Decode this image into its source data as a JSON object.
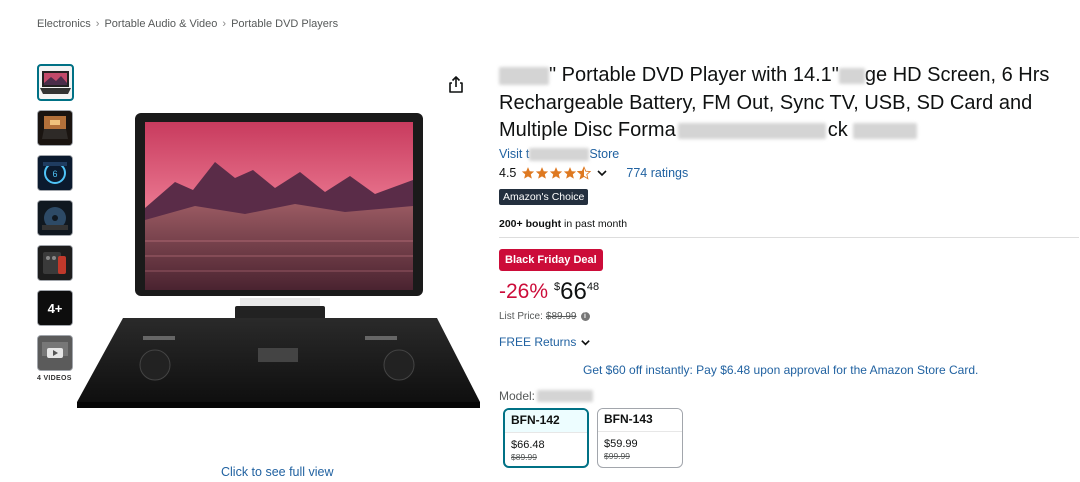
{
  "breadcrumb": [
    "Electronics",
    "Portable Audio & Video",
    "Portable DVD Players"
  ],
  "gallery": {
    "thumbnails": [
      "dvd-player-thumb",
      "battery-thumb",
      "screen-thumb",
      "disc-thumb",
      "remote-thumb",
      "age-4plus-thumb",
      "video-thumb"
    ],
    "thumb_4plus_label": "4+",
    "videos_label": "4 VIDEOS",
    "full_view_link": "Click to see full view"
  },
  "product": {
    "title_part1": "\" Portable DVD Player with 14.1\"",
    "title_part2": "ge HD Screen, 6 Hrs Rechargeable Battery, FM Out, Sync TV, USB, SD Card and Multiple Disc Forma",
    "title_part3": "ck",
    "store_prefix": "Visit t",
    "store_suffix": "Store",
    "rating": "4.5",
    "ratings_count": "774 ratings",
    "choice_badge": "Amazon's Choice",
    "bought_bold": "200+ bought",
    "bought_rest": " in past month"
  },
  "pricing": {
    "deal_badge": "Black Friday Deal",
    "discount": "-26%",
    "currency": "$",
    "price_whole": "66",
    "price_fraction": "48",
    "list_price_label": "List Price:",
    "list_price": "$89.99",
    "free_returns": "FREE Returns",
    "promo": "Get $60 off instantly: Pay $6.48 upon approval for the Amazon Store Card."
  },
  "model": {
    "label": "Model:",
    "variants": [
      {
        "name": "BFN-142",
        "price": "$66.48",
        "list": "$89.99",
        "selected": true
      },
      {
        "name": "BFN-143",
        "price": "$59.99",
        "list": "$99.99",
        "selected": false
      }
    ]
  },
  "colors": {
    "link": "#2162a1",
    "deal_red": "#cc0c39",
    "star": "#de7921",
    "selected_border": "#007185",
    "badge_dark": "#232f3e"
  }
}
